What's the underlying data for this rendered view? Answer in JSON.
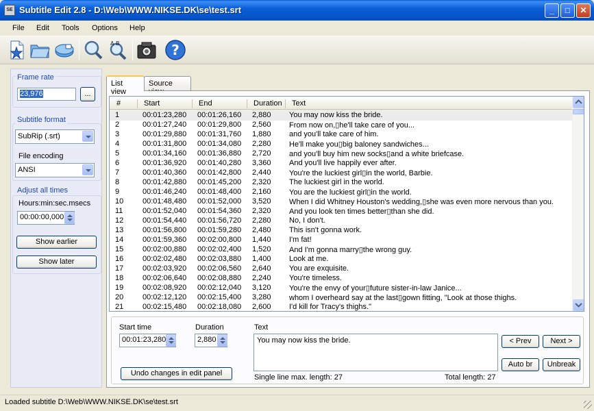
{
  "window": {
    "title": "Subtitle Edit 2.8 - D:\\Web\\WWW.NIKSE.DK\\se\\test.srt",
    "app_icon_text": "SE"
  },
  "menu": [
    "File",
    "Edit",
    "Tools",
    "Options",
    "Help"
  ],
  "toolbar": {
    "buttons": [
      {
        "name": "new-icon"
      },
      {
        "name": "open-icon"
      },
      {
        "name": "save-icon"
      },
      {
        "name": "find-icon"
      },
      {
        "name": "replace-icon"
      },
      {
        "name": "visual-sync-icon"
      },
      {
        "name": "help-icon"
      }
    ],
    "replace_label": "A B"
  },
  "left": {
    "frame_rate_title": "Frame rate",
    "frame_rate_value": "23,976",
    "browse_label": "...",
    "subtitle_format_title": "Subtitle format",
    "subtitle_format_value": "SubRip (.srt)",
    "file_encoding_label": "File encoding",
    "file_encoding_value": "ANSI",
    "adjust_title": "Adjust all times",
    "time_format_label": "Hours:min:sec.msecs",
    "adjust_value": "00:00:00,000",
    "show_earlier": "Show earlier",
    "show_later": "Show later"
  },
  "tabs": [
    "List view",
    "Source view"
  ],
  "list": {
    "columns": [
      "#",
      "Start",
      "End",
      "Duration",
      "Text"
    ],
    "rows": [
      [
        "1",
        "00:01:23,280",
        "00:01:26,160",
        "2,880",
        "You may now kiss the bride."
      ],
      [
        "2",
        "00:01:27,240",
        "00:01:29,800",
        "2,560",
        "From now on,▯he'll take care of you..."
      ],
      [
        "3",
        "00:01:29,880",
        "00:01:31,760",
        "1,880",
        "and you'll take care of him."
      ],
      [
        "4",
        "00:01:31,800",
        "00:01:34,080",
        "2,280",
        "He'll make you▯big baloney sandwiches..."
      ],
      [
        "5",
        "00:01:34,160",
        "00:01:36,880",
        "2,720",
        "and you'll buy him new socks▯and a white briefcase."
      ],
      [
        "6",
        "00:01:36,920",
        "00:01:40,280",
        "3,360",
        "And you'll live happily ever after."
      ],
      [
        "7",
        "00:01:40,360",
        "00:01:42,800",
        "2,440",
        "You're the luckiest girl▯in the world, Barbie."
      ],
      [
        "8",
        "00:01:42,880",
        "00:01:45,200",
        "2,320",
        "The luckiest girl in the world."
      ],
      [
        "9",
        "00:01:46,240",
        "00:01:48,400",
        "2,160",
        "You are the luckiest girl▯in the world."
      ],
      [
        "10",
        "00:01:48,480",
        "00:01:52,000",
        "3,520",
        "When I did Whitney Houston's wedding,▯she was even more nervous than you."
      ],
      [
        "11",
        "00:01:52,040",
        "00:01:54,360",
        "2,320",
        "And you look ten times better▯than she did."
      ],
      [
        "12",
        "00:01:54,440",
        "00:01:56,720",
        "2,280",
        "No, I don't."
      ],
      [
        "13",
        "00:01:56,800",
        "00:01:59,280",
        "2,480",
        "This isn't gonna work."
      ],
      [
        "14",
        "00:01:59,360",
        "00:02:00,800",
        "1,440",
        "I'm fat!"
      ],
      [
        "15",
        "00:02:00,880",
        "00:02:02,400",
        "1,520",
        "And I'm gonna marry▯the wrong guy."
      ],
      [
        "16",
        "00:02:02,480",
        "00:02:03,880",
        "1,400",
        "Look at me."
      ],
      [
        "17",
        "00:02:03,920",
        "00:02:06,560",
        "2,640",
        "You are exquisite."
      ],
      [
        "18",
        "00:02:06,640",
        "00:02:08,880",
        "2,240",
        "You're timeless."
      ],
      [
        "19",
        "00:02:08,920",
        "00:02:12,040",
        "3,120",
        "You're the envy of your▯future sister-in-law Janice..."
      ],
      [
        "20",
        "00:02:12,120",
        "00:02:15,400",
        "3,280",
        "whom I overheard say at the last▯gown fitting, \"Look at those thighs."
      ],
      [
        "21",
        "00:02:15,480",
        "00:02:18,080",
        "2,600",
        "I'd kill for Tracy's thighs.\""
      ]
    ]
  },
  "edit": {
    "start_time_label": "Start time",
    "start_time_value": "00:01:23,280",
    "duration_label": "Duration",
    "duration_value": "2,880",
    "text_label": "Text",
    "text_value": "You may now kiss the bride.",
    "undo_label": "Undo changes in edit panel",
    "single_line_label": "Single line max. length: 27",
    "total_length_label": "Total length: 27",
    "prev_label": "< Prev",
    "next_label": "Next >",
    "auto_br_label": "Auto br",
    "unbreak_label": "Unbreak"
  },
  "status": {
    "text": "Loaded subtitle D:\\Web\\WWW.NIKSE.DK\\se\\test.srt"
  }
}
